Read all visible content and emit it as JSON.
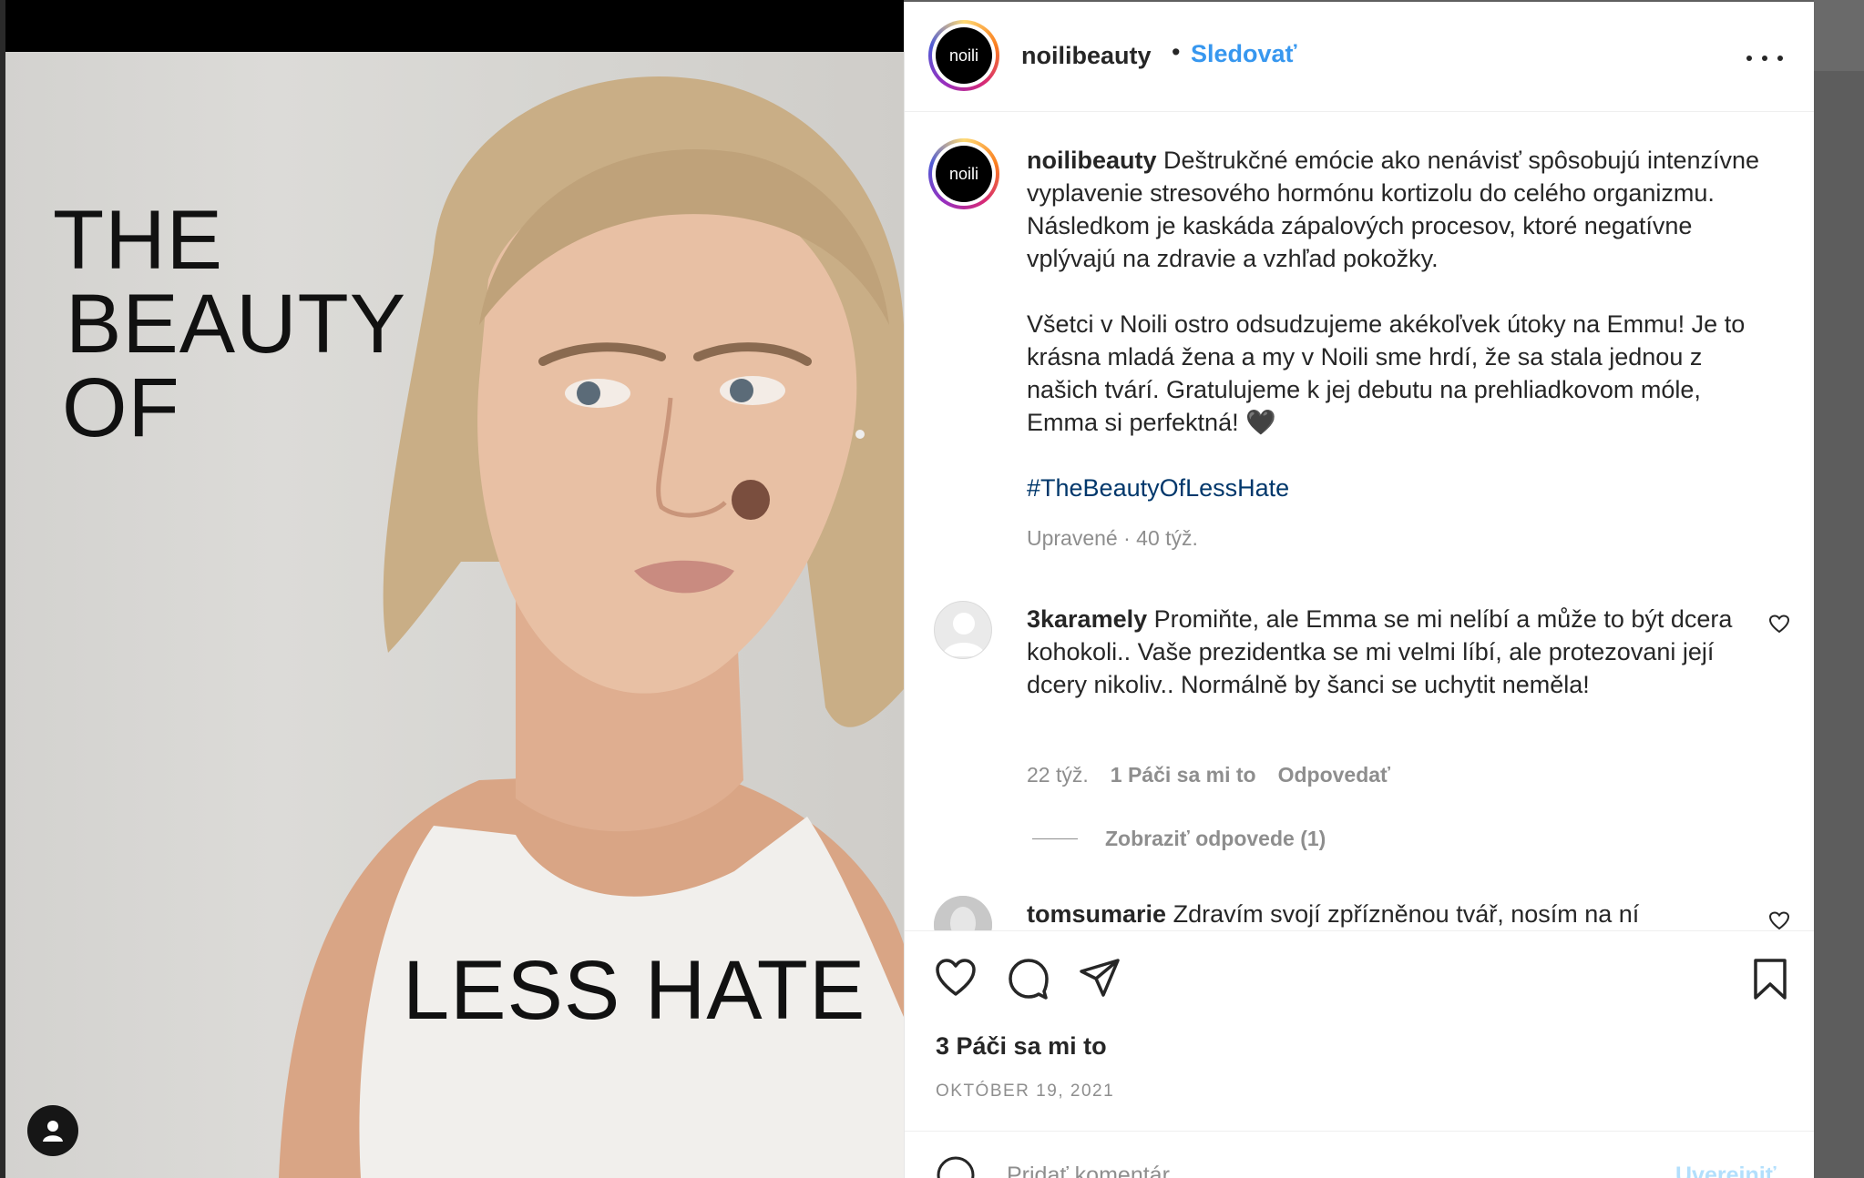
{
  "post_image": {
    "poster_lines": [
      "THE",
      "BEAUTY",
      "OF"
    ],
    "poster_bottom": "LESS HATE"
  },
  "header": {
    "avatar_text": "noili",
    "username": "noilibeauty",
    "separator": "•",
    "follow_label": "Sledovať"
  },
  "caption": {
    "avatar_text": "noili",
    "username": "noilibeauty",
    "paragraph1": "Deštrukčné emócie ako nenávisť spôsobujú intenzívne vyplavenie stresového hormónu kortizolu do celého organizmu. Následkom je kaskáda zápalových procesov, ktoré negatívne vplývajú na zdravie a vzhľad pokožky.",
    "paragraph2": "Všetci v Noili ostro odsudzujeme akékoľvek útoky na Emmu! Je to krásna mladá žena a my v Noili sme hrdí, že sa stala jednou z našich tvárí. Gratulujeme k jej debutu na prehliadkovom móle, Emma si perfektná! 🖤",
    "hashtag": "#TheBeautyOfLessHate",
    "meta": "Upravené · 40 týž."
  },
  "comments": [
    {
      "username": "3karamely",
      "text": "Promiňte, ale Emma se mi nelíbí a může to být dcera kohokoli.. Vaše prezidentka se mi velmi líbí, ale protezovani její dcery nikoliv.. Normálně by šanci se uchytit neměla!",
      "time": "22 týž.",
      "likes": "1 Páči sa mi to",
      "reply": "Odpovedať",
      "view_replies": "Zobraziť odpovede (1)"
    },
    {
      "username": "tomsumarie",
      "text": "Zdravím svojí zpřízněnou tvář, nosím na ní"
    }
  ],
  "actions": {
    "like_icon": "heart-icon",
    "comment_icon": "comment-icon",
    "share_icon": "paper-plane-icon",
    "save_icon": "bookmark-icon"
  },
  "likes_text": "3 Páči sa mi to",
  "post_date": "OKTÓBER 19, 2021",
  "add_comment": {
    "placeholder": "Pridať komentár...",
    "publish_label": "Uverejniť"
  },
  "colors": {
    "link_blue": "#3797ef",
    "hashtag": "#00376b",
    "muted": "#8e8e8e"
  }
}
